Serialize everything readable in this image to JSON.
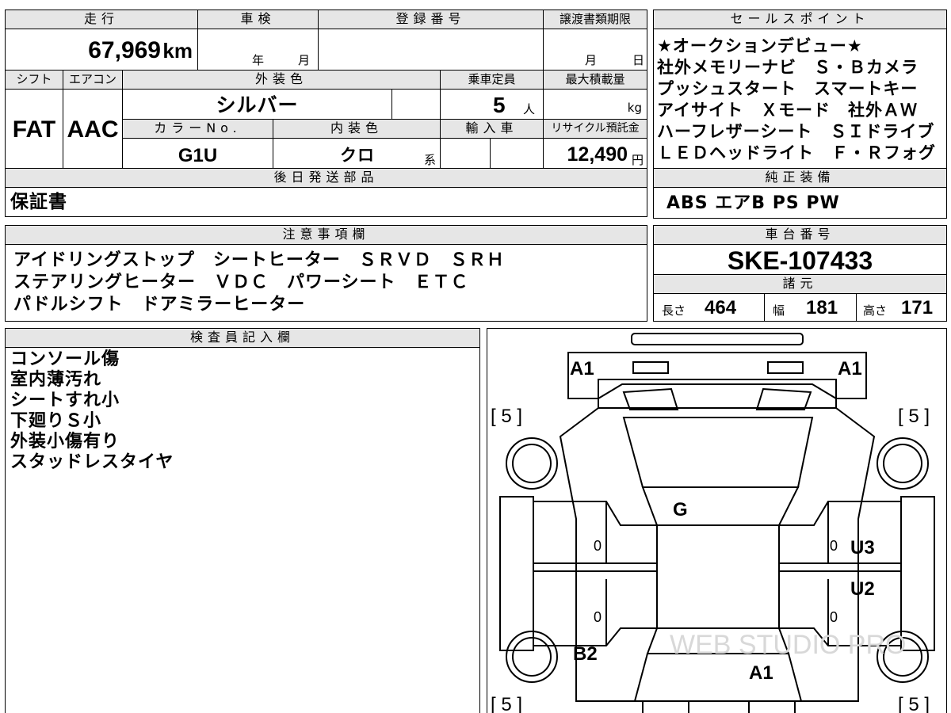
{
  "top": {
    "mileage_label": "走行",
    "mileage_value": "67,969",
    "mileage_unit": "km",
    "inspection_label": "車検",
    "inspection_year_unit": "年",
    "inspection_month_unit": "月",
    "registration_label": "登録番号",
    "transfer_label": "譲渡書類期限",
    "transfer_month_unit": "月",
    "transfer_day_unit": "日"
  },
  "row2": {
    "shift_label": "シフト",
    "shift_value": "FAT",
    "ac_label": "エアコン",
    "ac_value": "AAC",
    "ext_color_label": "外装色",
    "ext_color_value": "シルバー",
    "capacity_label": "乗車定員",
    "capacity_value": "5",
    "capacity_unit": "人",
    "max_load_label": "最大積載量",
    "max_load_unit": "kg",
    "color_no_label": "カラーNo.",
    "color_no_value": "G1U",
    "int_color_label": "内装色",
    "int_color_value": "クロ",
    "int_color_suffix": "系",
    "import_label": "輸入車",
    "recycle_label": "リサイクル預託金",
    "recycle_value": "12,490",
    "recycle_unit": "円"
  },
  "later_parts": {
    "label": "後日発送部品",
    "value": "保証書"
  },
  "sales_points": {
    "label": "セールスポイント",
    "lines": [
      "★オークションデビュー★",
      "社外メモリーナビ　Ｓ・Ｂカメラ",
      "プッシュスタート　スマートキー",
      "アイサイト　Ｘモード　社外ＡＷ",
      "ハーフレザーシート　ＳＩドライブ",
      "ＬＥＤヘッドライト　Ｆ・Ｒフォグ"
    ]
  },
  "genuine_equipment": {
    "label": "純正装備",
    "value": "ABS エアB PS PW"
  },
  "notes": {
    "label": "注意事項欄",
    "lines": [
      "アイドリングストップ　シートヒーター　ＳＲＶＤ　ＳＲＨ",
      "ステアリングヒーター　ＶＤＣ　パワーシート　ＥＴＣ",
      "パドルシフト　ドアミラーヒーター"
    ]
  },
  "chassis": {
    "label": "車台番号",
    "value": "SKE-107433"
  },
  "specs": {
    "label": "諸元",
    "length_label": "長さ",
    "length_value": "464",
    "width_label": "幅",
    "width_value": "181",
    "height_label": "高さ",
    "height_value": "171"
  },
  "inspector": {
    "label": "検査員記入欄",
    "lines": [
      "コンソール傷",
      "室内薄汚れ",
      "シートすれ小",
      "下廻りＳ小",
      "外装小傷有り",
      "スタッドレスタイヤ"
    ]
  },
  "diagram": {
    "marks": {
      "front_left": "A1",
      "front_right": "A1",
      "roof": "G",
      "right_rear_door": "U3",
      "right_rear_panel": "U2",
      "left_rear": "B2",
      "rear": "A1",
      "tire_fl": "[ 5 ]",
      "tire_fr": "[ 5 ]",
      "tire_rl": "[ 5 ]",
      "tire_rr": "[ 5 ]",
      "door_zero": "0"
    },
    "watermark": "WEB STUDIO PRO"
  }
}
